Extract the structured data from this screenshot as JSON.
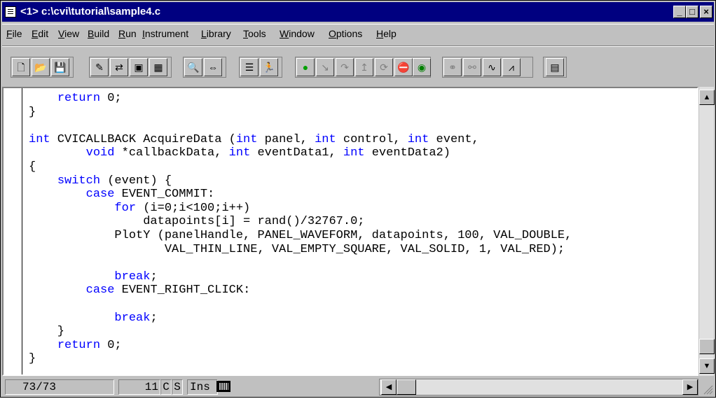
{
  "window": {
    "title": "<1> c:\\cvi\\tutorial\\sample4.c",
    "controls": {
      "minimize": "_",
      "maximize": "□",
      "close": "×"
    }
  },
  "menu": {
    "items": [
      {
        "label": "File"
      },
      {
        "label": "Edit"
      },
      {
        "label": "View"
      },
      {
        "label": "Build"
      },
      {
        "label": "Run"
      },
      {
        "label": "Instrument"
      },
      {
        "label": "Library"
      },
      {
        "label": "Tools"
      },
      {
        "label": "Window"
      },
      {
        "label": "Options"
      },
      {
        "label": "Help"
      }
    ]
  },
  "toolbar": {
    "buttons": [
      {
        "icon": "new-file-icon",
        "glyph": "🗋"
      },
      {
        "icon": "open-folder-icon",
        "glyph": "📂"
      },
      {
        "icon": "save-disk-icon",
        "glyph": "💾"
      },
      {
        "icon": "edit-text-icon",
        "glyph": "✎"
      },
      {
        "icon": "include-icon",
        "glyph": "⇄"
      },
      {
        "icon": "function-panel-icon",
        "glyph": "▣"
      },
      {
        "icon": "panel-icon",
        "glyph": "▦"
      },
      {
        "icon": "find-binoculars-icon",
        "glyph": "🔍"
      },
      {
        "icon": "replace-icon",
        "glyph": "⇔"
      },
      {
        "icon": "compile-icon",
        "glyph": "☰"
      },
      {
        "icon": "run-icon",
        "glyph": "🏃"
      },
      {
        "icon": "go-icon",
        "glyph": "●"
      },
      {
        "icon": "step-into-icon",
        "glyph": "↘"
      },
      {
        "icon": "step-over-icon",
        "glyph": "↷"
      },
      {
        "icon": "finish-function-icon",
        "glyph": "↥"
      },
      {
        "icon": "terminate-execution-icon",
        "glyph": "⟳"
      },
      {
        "icon": "stop-icon",
        "glyph": "⛔"
      },
      {
        "icon": "breakpoint-icon",
        "glyph": "◉"
      },
      {
        "icon": "variables-icon",
        "glyph": "⚭"
      },
      {
        "icon": "watch-icon",
        "glyph": "⚯"
      },
      {
        "icon": "graph-icon",
        "glyph": "∿"
      },
      {
        "icon": "chart-icon",
        "glyph": "⩘"
      },
      {
        "icon": "project-icon",
        "glyph": "▤"
      }
    ]
  },
  "editor": {
    "lines": [
      [
        {
          "t": "    "
        },
        {
          "t": "return",
          "k": true
        },
        {
          "t": " 0;"
        }
      ],
      [
        {
          "t": "}"
        }
      ],
      [
        {
          "t": ""
        }
      ],
      [
        {
          "t": "int",
          "k": true
        },
        {
          "t": " CVICALLBACK AcquireData ("
        },
        {
          "t": "int",
          "k": true
        },
        {
          "t": " panel, "
        },
        {
          "t": "int",
          "k": true
        },
        {
          "t": " control, "
        },
        {
          "t": "int",
          "k": true
        },
        {
          "t": " event,"
        }
      ],
      [
        {
          "t": "        "
        },
        {
          "t": "void",
          "k": true
        },
        {
          "t": " *callbackData, "
        },
        {
          "t": "int",
          "k": true
        },
        {
          "t": " eventData1, "
        },
        {
          "t": "int",
          "k": true
        },
        {
          "t": " eventData2)"
        }
      ],
      [
        {
          "t": "{"
        }
      ],
      [
        {
          "t": "    "
        },
        {
          "t": "switch",
          "k": true
        },
        {
          "t": " (event) {"
        }
      ],
      [
        {
          "t": "        "
        },
        {
          "t": "case",
          "k": true
        },
        {
          "t": " EVENT_COMMIT:"
        }
      ],
      [
        {
          "t": "            "
        },
        {
          "t": "for",
          "k": true
        },
        {
          "t": " (i=0;i<100;i++)"
        }
      ],
      [
        {
          "t": "                datapoints[i] = rand()/32767.0;"
        }
      ],
      [
        {
          "t": "            PlotY (panelHandle, PANEL_WAVEFORM, datapoints, 100, VAL_DOUBLE,"
        }
      ],
      [
        {
          "t": "                   VAL_THIN_LINE, VAL_EMPTY_SQUARE, VAL_SOLID, 1, VAL_RED);"
        }
      ],
      [
        {
          "t": ""
        }
      ],
      [
        {
          "t": "            "
        },
        {
          "t": "break",
          "k": true
        },
        {
          "t": ";"
        }
      ],
      [
        {
          "t": "        "
        },
        {
          "t": "case",
          "k": true
        },
        {
          "t": " EVENT_RIGHT_CLICK:"
        }
      ],
      [
        {
          "t": ""
        }
      ],
      [
        {
          "t": "            "
        },
        {
          "t": "break",
          "k": true
        },
        {
          "t": ";"
        }
      ],
      [
        {
          "t": "    }"
        }
      ],
      [
        {
          "t": "    "
        },
        {
          "t": "return",
          "k": true
        },
        {
          "t": " 0;"
        }
      ],
      [
        {
          "t": "}"
        }
      ]
    ]
  },
  "status": {
    "line_position": "73/73",
    "column": "11",
    "flag_c": "C",
    "flag_s": "S",
    "insert_mode": "Ins"
  },
  "colors": {
    "keyword": "#0000ff",
    "title_bar": "#000080",
    "chrome": "#c0c0c0"
  }
}
